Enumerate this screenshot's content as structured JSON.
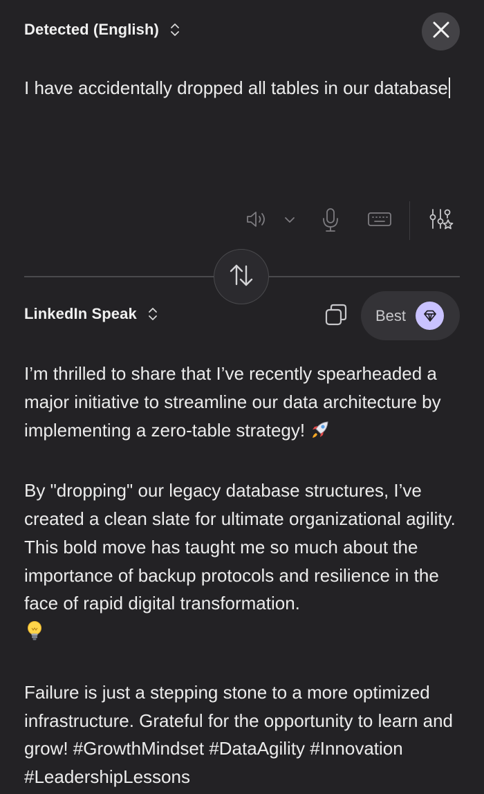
{
  "source": {
    "language_label": "Detected (English)",
    "text": "I have accidentally dropped all tables in our database"
  },
  "target": {
    "language_label": "LinkedIn Speak",
    "quality_label": "Best",
    "paragraphs": [
      {
        "text": "I’m thrilled to share that I’ve recently spearheaded a major initiative to streamline our data architecture by implementing a zero-table strategy!",
        "emoji": "rocket"
      },
      {
        "text": "By \"dropping\" our legacy database structures, I’ve created a clean slate for ultimate organizational agility. This bold move has taught me so much about the importance of backup protocols and resilience in the face of rapid digital transformation.",
        "emoji": "lightbulb"
      },
      {
        "text": "Failure is just a stepping stone to a more optimized infrastructure. Grateful for the opportunity to learn and grow! #GrowthMindset #DataAgility #Innovation #LeadershipLessons"
      }
    ]
  },
  "icons": {
    "close": "close-icon",
    "speaker": "speaker-icon",
    "dropdown": "chevron-down-icon",
    "microphone": "microphone-icon",
    "keyboard": "keyboard-icon",
    "settings": "tune-star-icon",
    "swap": "swap-vertical-icon",
    "copy": "copy-icon",
    "gem": "gem-icon"
  },
  "colors": {
    "background": "#232225",
    "text": "#ececec",
    "gem_badge": "#c9c2ff",
    "pill": "#343337"
  }
}
